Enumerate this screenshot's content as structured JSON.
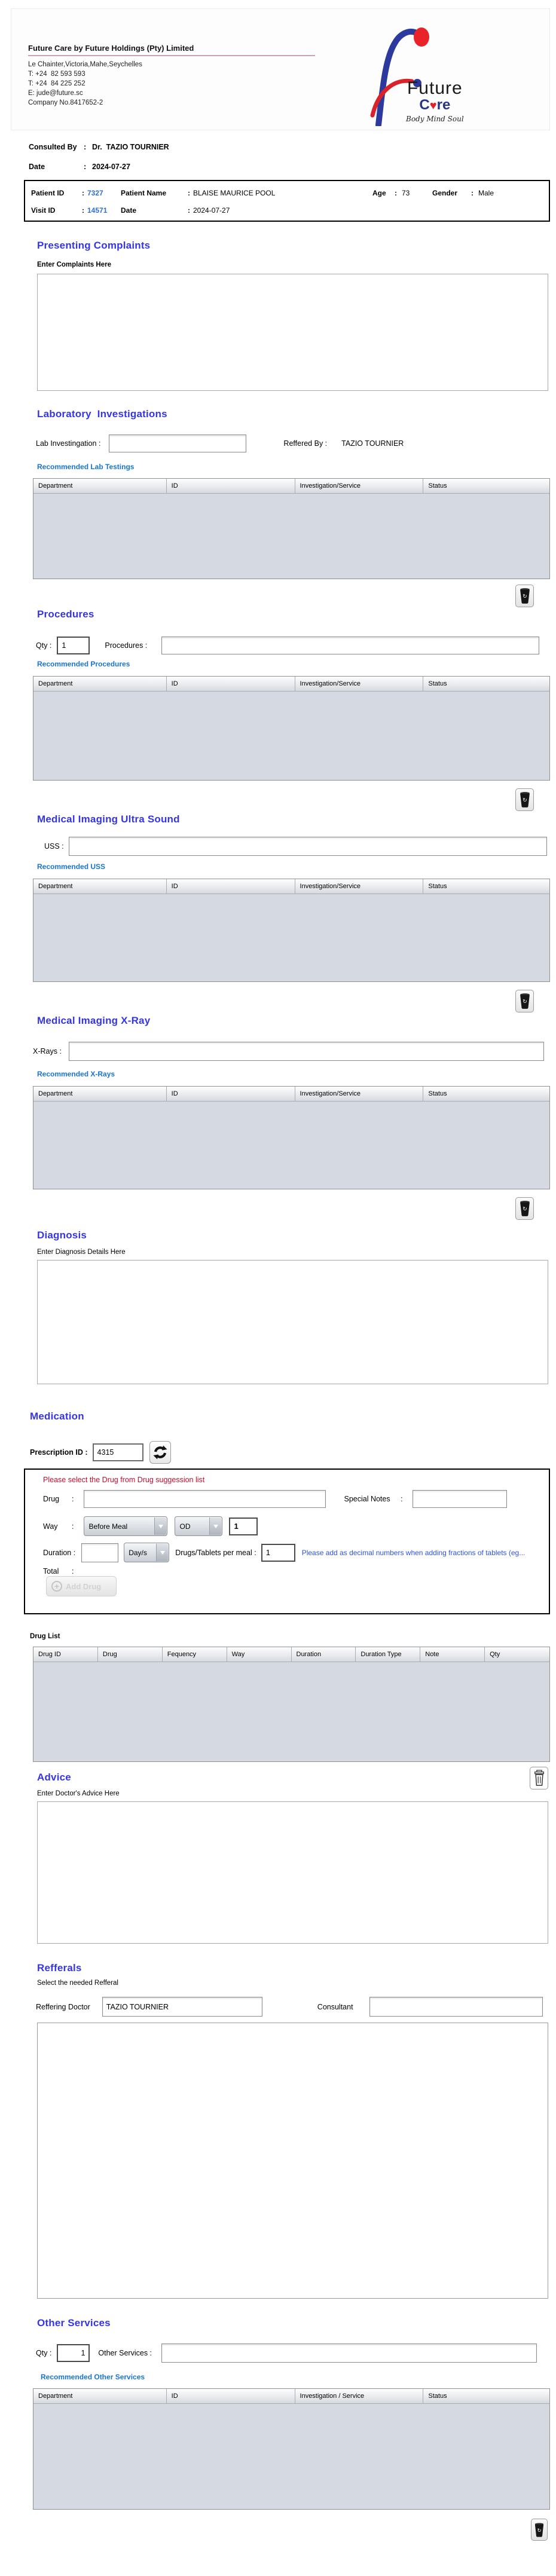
{
  "punct": {
    "colon": ":"
  },
  "header": {
    "company_name": "Future Care by Future Holdings (Pty) Limited",
    "address": "Le Chainter,Victoria,Mahe,Seychelles",
    "phone1": "T: +24  82 593 593",
    "phone2": "T: +24  84 225 252",
    "email": "E: jude@future.sc",
    "company_no": "Company No.8417652-2",
    "logo": {
      "future": "Future",
      "care_c": "C",
      "care_re": "re",
      "tagline": "Body Mind Soul"
    }
  },
  "consultation": {
    "consulted_by_label": "Consulted By",
    "consulted_by": "Dr.  TAZIO TOURNIER",
    "date_label": "Date",
    "date": "2024-07-27"
  },
  "patient": {
    "patient_id_label": "Patient ID",
    "patient_id": "7327",
    "patient_name_label": "Patient Name",
    "patient_name": "BLAISE MAURICE POOL",
    "age_label": "Age",
    "age": "73",
    "gender_label": "Gender",
    "gender": "Male",
    "visit_id_label": "Visit ID",
    "visit_id": "14571",
    "date_label": "Date",
    "date": "2024-07-27"
  },
  "complaints": {
    "title": "Presenting Complaints",
    "label": "Enter Complaints Here"
  },
  "lab": {
    "title": "Laboratory  Investigations",
    "input_label": "Lab Investingation :",
    "referred_by_label": "Reffered By :",
    "referred_by": "TAZIO TOURNIER",
    "recommended_label": "Recommended Lab Testings",
    "table_headers": [
      "Department",
      "ID",
      "Investigation/Service",
      "Status"
    ]
  },
  "procedures": {
    "title": "Procedures",
    "qty_label": "Qty :",
    "qty_value": "1",
    "input_label": "Procedures :",
    "recommended_label": "Recommended Procedures",
    "table_headers": [
      "Department",
      "ID",
      "Investigation/Service",
      "Status"
    ]
  },
  "uss": {
    "title": "Medical Imaging Ultra Sound",
    "input_label": "USS :",
    "recommended_label": "Recommended USS",
    "table_headers": [
      "Department",
      "ID",
      "Investigation/Service",
      "Status"
    ]
  },
  "xray": {
    "title": "Medical Imaging X-Ray",
    "input_label": "X-Rays :",
    "recommended_label": "Recommended X-Rays",
    "table_headers": [
      "Department",
      "ID",
      "Investigation/Service",
      "Status"
    ]
  },
  "diagnosis": {
    "title": "Diagnosis",
    "label": "Enter Diagnosis Details Here"
  },
  "medication": {
    "title": "Medication",
    "prescription_id_label": "Prescription ID :",
    "prescription_id": "4315",
    "warning": "Please select the Drug from Drug suggession list",
    "drug_label": "Drug",
    "special_notes_label": "Special Notes ",
    "way_label": "Way",
    "way_meal": "Before Meal",
    "way_freq": "OD",
    "way_qty": "1",
    "duration_label": "Duration :",
    "duration_type": "Day/s",
    "per_meal_label": "Drugs/Tablets per meal :",
    "per_meal_value": "1",
    "fraction_note": "Please add as decimal numbers when adding fractions of tablets (eg...",
    "total_label": "Total",
    "add_drug_label": "Add Drug",
    "drug_list_label": "Drug List",
    "table_headers": [
      "Drug ID",
      "Drug",
      "Fequency",
      "Way",
      "Duration",
      "Duration Type",
      "Note",
      "Qty"
    ]
  },
  "advice": {
    "title": "Advice",
    "label": "Enter Doctor's Advice Here"
  },
  "referrals": {
    "title": "Refferals",
    "subtitle": "Select the needed Refferal",
    "doctor_label": "Reffering Doctor",
    "doctor_value": "TAZIO TOURNIER",
    "consultant_label": "Consultant"
  },
  "other_services": {
    "title": "Other Services",
    "qty_label": "Qty :",
    "qty_value": "1",
    "input_label": "Other Services :",
    "recommended_label": "Recommended Other Services",
    "table_headers": [
      "Department",
      "ID",
      "Investigation / Service",
      "Status"
    ]
  }
}
